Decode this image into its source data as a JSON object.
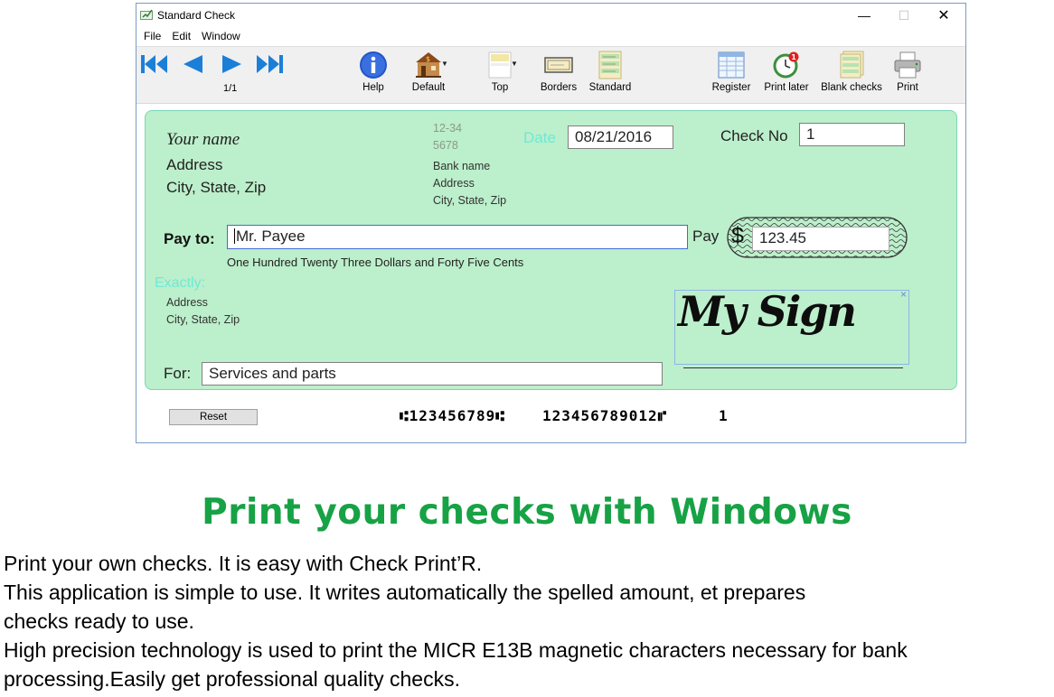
{
  "window": {
    "title": "Standard Check",
    "controls": {
      "minimize": "—",
      "maximize": "☐",
      "close": "✕"
    }
  },
  "menu": [
    "File",
    "Edit",
    "Window"
  ],
  "toolbar": {
    "counter": "1/1",
    "items": {
      "help": "Help",
      "default": "Default",
      "top": "Top",
      "borders": "Borders",
      "standard": "Standard",
      "register": "Register",
      "print_later": "Print later",
      "blank_checks": "Blank checks",
      "print": "Print"
    },
    "print_later_badge": "1",
    "accent_color": "#1b7fd8"
  },
  "check": {
    "payer_name": "Your name",
    "payer_address": "Address",
    "payer_city": "City, State, Zip",
    "routing_fraction_1": "12-34",
    "routing_fraction_2": "5678",
    "bank_name": "Bank name",
    "bank_address": "Address",
    "bank_city": "City, State, Zip",
    "date_label": "Date",
    "date_value": "08/21/2016",
    "check_no_label": "Check No",
    "check_no_value": "1",
    "pay_to_label": "Pay to:",
    "payee_value": "Mr. Payee",
    "pay_label": "Pay",
    "currency_symbol": "$",
    "amount_value": "123.45",
    "amount_words": "One Hundred Twenty Three Dollars and Forty Five Cents",
    "exactly_label": "Exactly:",
    "payee_address": "Address",
    "payee_city": "City, State, Zip",
    "signature_text": "My Sign",
    "signature_close": "×",
    "for_label": "For:",
    "memo_value": "Services and parts",
    "background_color": "#bcefcb"
  },
  "footer": {
    "reset_label": "Reset",
    "micr_routing": "⑆123456789⑆",
    "micr_account": "123456789012⑈",
    "micr_check": "1"
  },
  "marketing": {
    "headline": "Print your checks with Windows",
    "headline_color": "#17a245",
    "lines": [
      "Print your own checks. It is easy with Check Print’R.",
      "This application is simple to use. It writes automatically the spelled amount, et prepares",
      "checks ready to use.",
      "High precision technology is used to print the MICR E13B magnetic characters necessary for bank",
      "processing.Easily get professional quality checks."
    ]
  }
}
